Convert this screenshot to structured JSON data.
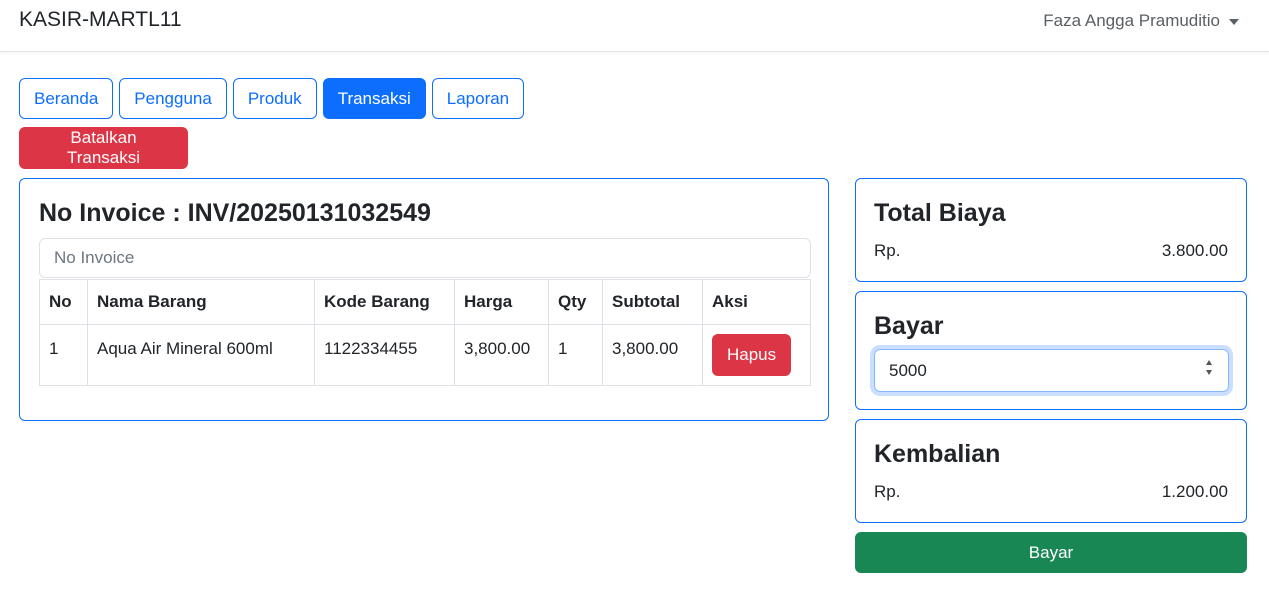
{
  "navbar": {
    "brand": "KASIR-MARTL11",
    "user": "Faza Angga Pramuditio"
  },
  "nav": {
    "items": [
      {
        "label": "Beranda",
        "active": false
      },
      {
        "label": "Pengguna",
        "active": false
      },
      {
        "label": "Produk",
        "active": false
      },
      {
        "label": "Transaksi",
        "active": true
      },
      {
        "label": "Laporan",
        "active": false
      }
    ]
  },
  "actions": {
    "cancel_label": "Batalkan Transaksi"
  },
  "invoice": {
    "title": "No Invoice : INV/20250131032549",
    "input_placeholder": "No Invoice"
  },
  "table": {
    "headers": [
      "No",
      "Nama Barang",
      "Kode Barang",
      "Harga",
      "Qty",
      "Subtotal",
      "Aksi"
    ],
    "rows": [
      {
        "no": "1",
        "nama": "Aqua Air Mineral 600ml",
        "kode": "1122334455",
        "harga": "3,800.00",
        "qty": "1",
        "subtotal": "3,800.00",
        "action": "Hapus"
      }
    ]
  },
  "summary": {
    "total": {
      "title": "Total Biaya",
      "currency": "Rp.",
      "value": "3.800.00"
    },
    "bayar": {
      "title": "Bayar",
      "value": "5000"
    },
    "kembalian": {
      "title": "Kembalian",
      "currency": "Rp.",
      "value": "1.200.00"
    },
    "pay_label": "Bayar"
  },
  "colors": {
    "primary": "#0d6efd",
    "danger": "#dc3545",
    "success": "#198754"
  }
}
